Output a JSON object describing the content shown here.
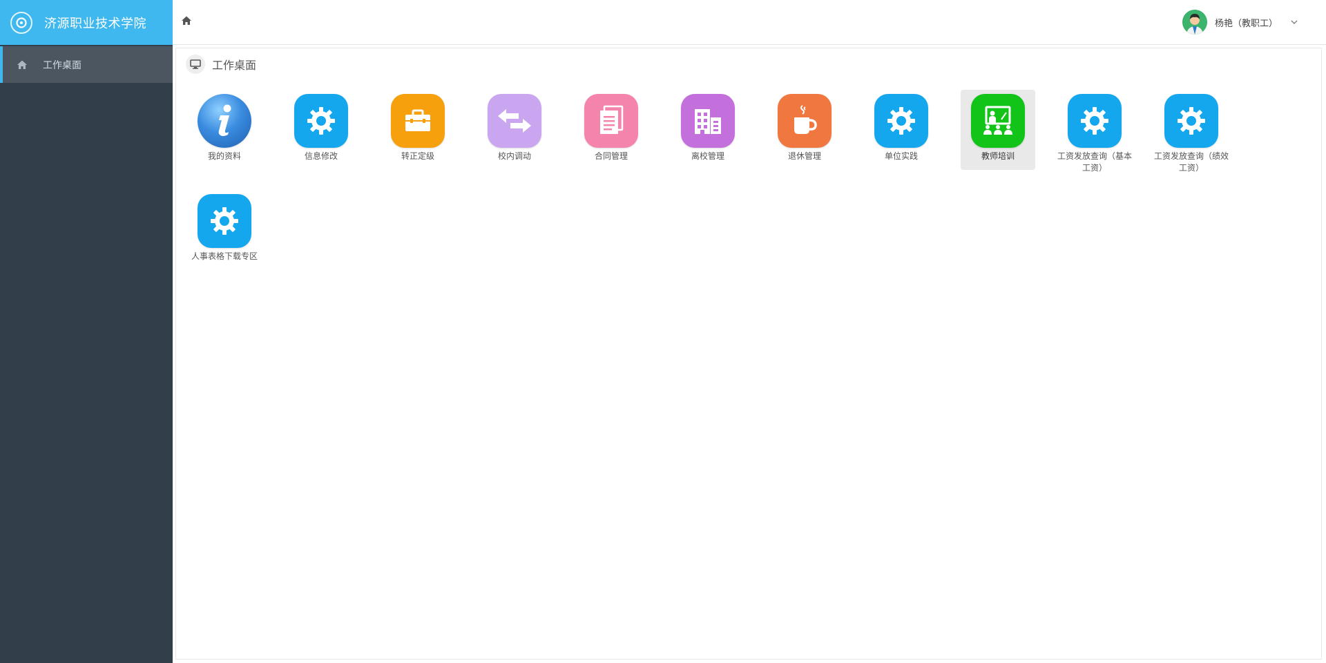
{
  "app": {
    "title": "济源职业技术学院"
  },
  "sidebar": {
    "items": [
      {
        "label": "工作桌面",
        "icon": "home-icon"
      }
    ]
  },
  "header": {
    "user": "杨艳（教职工）"
  },
  "page": {
    "title": "工作桌面"
  },
  "tiles": [
    {
      "label": "我的资料",
      "icon": "info-icon",
      "color": "#2b7bd0"
    },
    {
      "label": "信息修改",
      "icon": "gear-icon",
      "color": "#14a7ee"
    },
    {
      "label": "转正定级",
      "icon": "briefcase-icon",
      "color": "#f5a00c"
    },
    {
      "label": "校内调动",
      "icon": "transfer-arrows-icon",
      "color": "#c9a6ef"
    },
    {
      "label": "合同管理",
      "icon": "document-icon",
      "color": "#f484ac"
    },
    {
      "label": "离校管理",
      "icon": "building-icon",
      "color": "#c36fdc"
    },
    {
      "label": "退休管理",
      "icon": "coffee-cup-icon",
      "color": "#f07840"
    },
    {
      "label": "单位实践",
      "icon": "gear-icon",
      "color": "#14a7ee"
    },
    {
      "label": "教师培训",
      "icon": "teacher-board-icon",
      "color": "#12c318",
      "selected": true
    },
    {
      "label": "工资发放查询（基本工资）",
      "icon": "gear-icon",
      "color": "#14a7ee"
    },
    {
      "label": "工资发放查询（绩效工资）",
      "icon": "gear-icon",
      "color": "#14a7ee"
    },
    {
      "label": "人事表格下载专区",
      "icon": "gear-icon",
      "color": "#14a7ee"
    }
  ]
}
